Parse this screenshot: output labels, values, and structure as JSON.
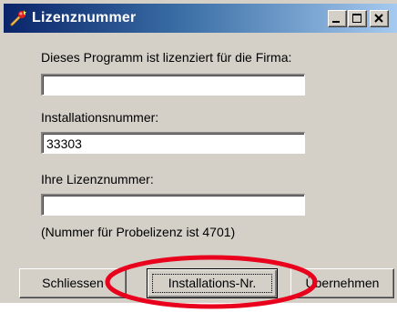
{
  "window": {
    "title": "Lizenznummer",
    "icon": "wand-key-icon"
  },
  "form": {
    "company_label": "Dieses Programm ist lizenziert für die Firma:",
    "company_value": "",
    "install_label": "Installationsnummer:",
    "install_value": "33303",
    "license_label": "Ihre Lizenznummer:",
    "license_value": "",
    "hint": "(Nummer für Probelizenz ist 4701)"
  },
  "buttons": {
    "close_label": "Schliessen",
    "install_label": "Installations-Nr.",
    "apply_label": "Übernehmen"
  },
  "colors": {
    "title_gradient_start": "#0a246a",
    "title_gradient_end": "#a6caf0",
    "dialog_bg": "#d4d0c8",
    "highlight_ring": "#e8001c"
  }
}
